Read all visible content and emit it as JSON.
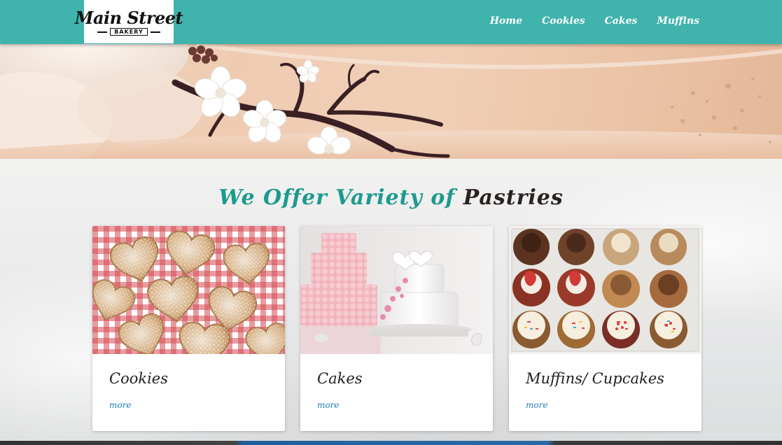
{
  "brand": {
    "name": "Main Street",
    "tagline": "BAKERY"
  },
  "nav": {
    "items": [
      {
        "label": "Home"
      },
      {
        "label": "Cookies"
      },
      {
        "label": "Cakes"
      },
      {
        "label": "Muffins"
      }
    ]
  },
  "section": {
    "title_part1": "We Offer Variety of ",
    "title_part2": "Pastries"
  },
  "cards": [
    {
      "title": "Cookies",
      "link": "more",
      "image": "heart-shaped sugar cookies"
    },
    {
      "title": "Cakes",
      "link": "more",
      "image": "tiered wedding cakes"
    },
    {
      "title": "Muffins/ Cupcakes",
      "link": "more",
      "image": "box of cupcakes"
    }
  ],
  "colors": {
    "nav_bg": "#3fb3ac",
    "title_teal": "#1d9a8f",
    "link_blue": "#1e7fb7"
  }
}
